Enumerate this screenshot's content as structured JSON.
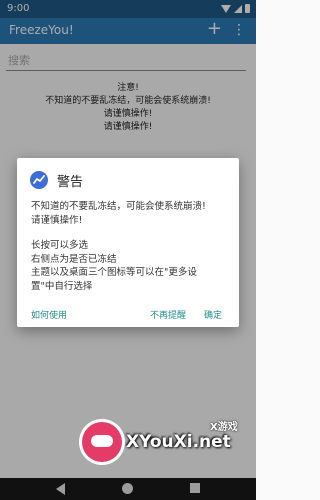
{
  "status_bar": {
    "time": "9:00",
    "icons": [
      "wifi-icon",
      "signal-icon",
      "battery-icon"
    ]
  },
  "toolbar": {
    "title": "FreezeYou!",
    "add_icon": "+",
    "more_icon": "⋮"
  },
  "search": {
    "placeholder": "搜索",
    "value": ""
  },
  "notice": {
    "line1": "注意!",
    "line2": "不知道的不要乱冻结，可能会使系统崩溃!",
    "line3": "请谨慎操作!",
    "line4": "请谨慎操作!"
  },
  "dialog": {
    "title": "警告",
    "icon": "app-logo-icon",
    "message_line1": "不知道的不要乱冻结，可能会使系统崩溃!",
    "message_line2": "请谨慎操作!",
    "message_line3": "长按可以多选",
    "message_line4": "右侧点为是否已冻结",
    "message_line5": "主题以及桌面三个图标等可以在\"更多设",
    "message_line6": "置\"中自行选择",
    "button_help": "如何使用",
    "button_no_remind": "不再提醒",
    "button_ok": "确定"
  },
  "watermark": {
    "small": "X游戏",
    "big": "XYouXi.net"
  },
  "colors": {
    "toolbar": "#2b79b4",
    "status_bar": "#1f5a86",
    "accent": "#1f8f8a",
    "app_icon": "#3d6ed6"
  }
}
